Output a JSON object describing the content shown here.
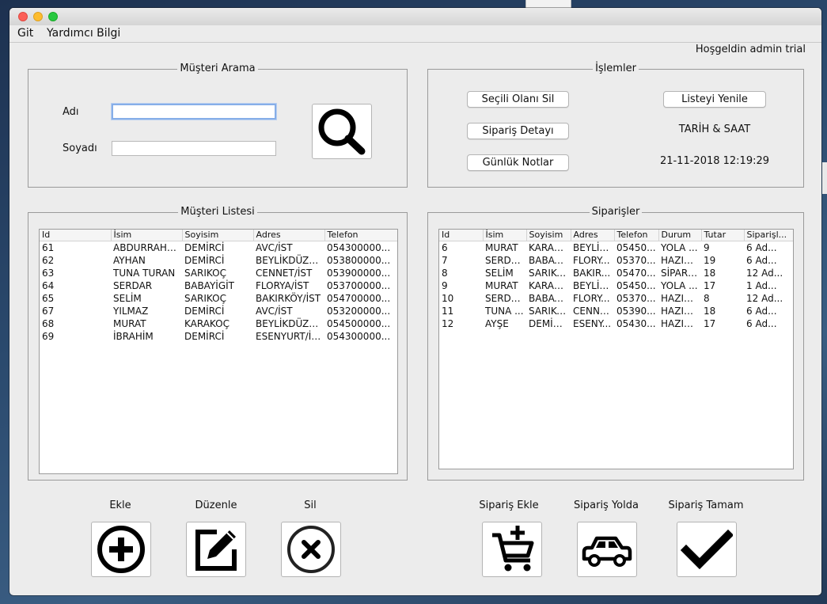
{
  "menu": {
    "items": [
      "Git",
      "Yardımcı Bilgi"
    ]
  },
  "welcome": "Hoşgeldin admin trial",
  "customer_search": {
    "title": "Müşteri Arama",
    "first_name_label": "Adı",
    "last_name_label": "Soyadı",
    "first_name_value": "",
    "last_name_value": "",
    "search_icon": "magnifier-icon"
  },
  "operations": {
    "title": "İşlemler",
    "delete_selected": "Seçili Olanı Sil",
    "refresh_list": "Listeyi Yenile",
    "order_detail": "Sipariş Detayı",
    "datetime_label": "TARİH & SAAT",
    "daily_notes": "Günlük Notlar",
    "datetime_value": "21-11-2018 12:19:29"
  },
  "customers": {
    "title": "Müşteri Listesi",
    "columns": [
      "Id",
      "İsim",
      "Soyisim",
      "Adres",
      "Telefon"
    ],
    "rows": [
      [
        "61",
        "ABDURRAHM...",
        "DEMİRCİ",
        "AVC/İST",
        "054300000..."
      ],
      [
        "62",
        "AYHAN",
        "DEMİRCİ",
        "BEYLİKDÜZÜ...",
        "053800000..."
      ],
      [
        "63",
        "TUNA TURAN",
        "SARIKOÇ",
        "CENNET/İST",
        "053900000..."
      ],
      [
        "64",
        "SERDAR",
        "BABAYİGİT",
        "FLORYA/İST",
        "053700000..."
      ],
      [
        "65",
        "SELİM",
        "SARIKOÇ",
        "BAKIRKÖY/İST",
        "054700000..."
      ],
      [
        "67",
        "YILMAZ",
        "DEMİRCİ",
        "AVC/İST",
        "053200000..."
      ],
      [
        "68",
        "MURAT",
        "KARAKOÇ",
        "BEYLİKDÜZÜ...",
        "054500000..."
      ],
      [
        "69",
        "İBRAHİM",
        "DEMİRCİ",
        "ESENYURT/İST",
        "054300000..."
      ]
    ]
  },
  "orders": {
    "title": "Siparişler",
    "columns": [
      "Id",
      "İsim",
      "Soyisim",
      "Adres",
      "Telefon",
      "Durum",
      "Tutar",
      "Siparişl..."
    ],
    "rows": [
      [
        "6",
        "MURAT",
        "KARAK...",
        "BEYLİK...",
        "05450...",
        "YOLA ...",
        "9",
        "6  Ad..."
      ],
      [
        "7",
        "SERDAR",
        "BABAYİ...",
        "FLORY...",
        "05370...",
        "HAZIR...",
        "19",
        "6  Ad..."
      ],
      [
        "8",
        "SELİM",
        "SARIKOÇ",
        "BAKIR...",
        "05470...",
        "SİPARİ...",
        "18",
        "12  Ad..."
      ],
      [
        "9",
        "MURAT",
        "KARAK...",
        "BEYLİK...",
        "05450...",
        "YOLA ...",
        "17",
        "1  Ad..."
      ],
      [
        "10",
        "SERDAR",
        "BABAYİ...",
        "FLORY...",
        "05370...",
        "HAZIR...",
        "8",
        "12  Ad..."
      ],
      [
        "11",
        "TUNA ...",
        "SARIKOÇ",
        "CENNE...",
        "05390...",
        "HAZIR...",
        "18",
        "6  Ad..."
      ],
      [
        "12",
        "AYŞE",
        "DEMİRCİ",
        "ESENY...",
        "05430...",
        "HAZIR...",
        "17",
        "6  Ad..."
      ]
    ]
  },
  "actions": {
    "add": "Ekle",
    "edit": "Düzenle",
    "delete": "Sil",
    "order_add": "Sipariş Ekle",
    "order_on_way": "Sipariş Yolda",
    "order_done": "Sipariş Tamam"
  },
  "icons": {
    "add": "plus-circle-icon",
    "edit": "edit-pencil-icon",
    "delete": "close-circle-icon",
    "order_add": "cart-add-icon",
    "order_on_way": "car-icon",
    "order_done": "checkmark-icon"
  }
}
